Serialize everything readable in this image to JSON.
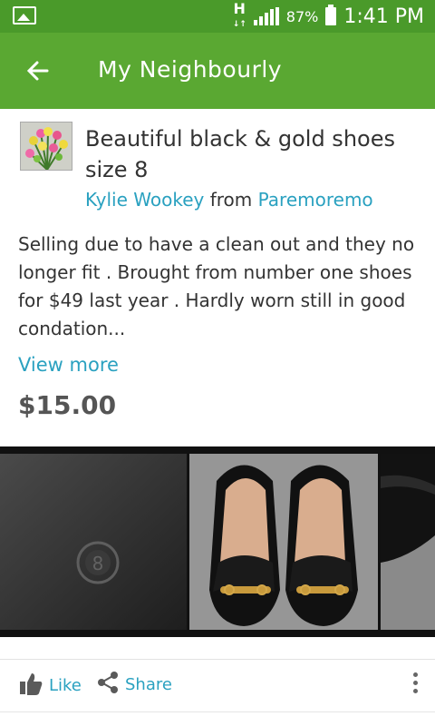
{
  "status_bar": {
    "network_badge": "H",
    "battery": "87%",
    "time": "1:41 PM"
  },
  "app_bar": {
    "title": "My Neighbourly"
  },
  "listing": {
    "title": "Beautiful black & gold shoes size 8",
    "author": "Kylie Wookey",
    "from_word": "from",
    "location": "Paremoremo",
    "description": "Selling due to have a clean out and they no longer fit . Brought from number one shoes for $49 last year . Hardly worn still in good condation...",
    "view_more": "View more",
    "price": "$15.00"
  },
  "actions": {
    "like": "Like",
    "share": "Share"
  },
  "icons": [
    "gallery-icon",
    "signal-icon",
    "battery-icon",
    "back-arrow-icon",
    "thumbs-up-icon",
    "share-icon",
    "more-vert-icon"
  ],
  "colors": {
    "status_bar": "#4a9a2a",
    "app_bar": "#5aa832",
    "link": "#2aa1c0"
  }
}
